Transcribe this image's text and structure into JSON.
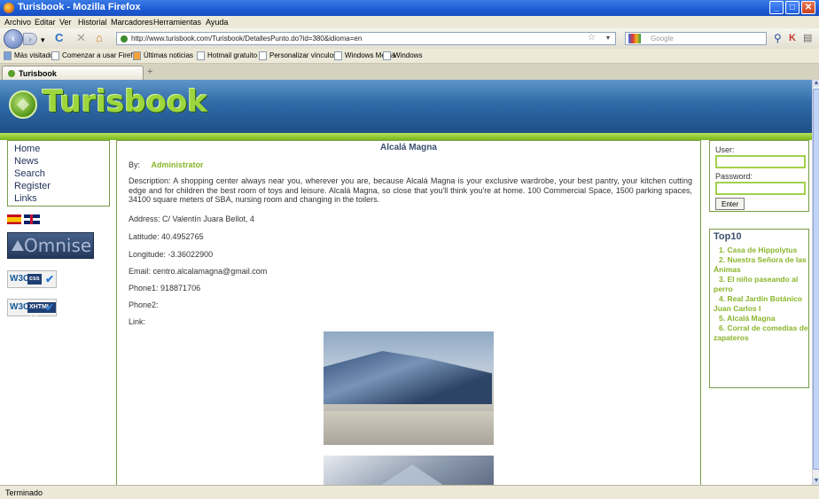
{
  "window": {
    "title": "Turisbook - Mozilla Firefox"
  },
  "menu": [
    "Archivo",
    "Editar",
    "Ver",
    "Historial",
    "Marcadores",
    "Herramientas",
    "Ayuda"
  ],
  "toolbar": {
    "url": "http://www.turisbook.com/Turisbook/DetallesPunto.do?id=380&idioma=en",
    "search_placeholder": "Google"
  },
  "bookmarks": [
    "Más visitados",
    "Comenzar a usar Firef...",
    "Últimas noticias",
    "Hotmail gratuito",
    "Personalizar vínculos",
    "Windows Media",
    "Windows"
  ],
  "tab": {
    "label": "Turisbook",
    "new_tab": "+"
  },
  "site": {
    "logo": "Turisbook"
  },
  "leftnav": [
    "Home",
    "News",
    "Search",
    "Register",
    "Links"
  ],
  "partner_logo": "Omnise",
  "badges": {
    "css": {
      "w3c": "W3C",
      "label": "css"
    },
    "xhtml": {
      "w3c": "W3C",
      "label": "XHTML 1.1"
    }
  },
  "place": {
    "title": "Alcalá Magna",
    "by_label": "By:",
    "author": "Administrator",
    "description": "Description: A shopping center always near you, wherever you are, because Alcalá Magna is your exclusive wardrobe, your best pantry, your kitchen cutting edge and for children the best room of toys and leisure. Alcalá Magna, so close that you'll think you're at home. 100 Commercial Space, 1500 parking spaces, 34100 square meters of SBA, nursing room and changing in the toilers.",
    "address": "Address: C/ Valentín Juara Bellot, 4",
    "latitude": "Latitude: 40.4952765",
    "longitude": "Longitude: -3.36022900",
    "email": "Email: centro.alcalamagna@gmail.com",
    "phone1": "Phone1: 918871706",
    "phone2": "Phone2:",
    "link": "Link:"
  },
  "login": {
    "user_label": "User:",
    "password_label": "Password:",
    "enter_label": "Enter"
  },
  "top10": {
    "heading": "Top10",
    "items": [
      "1. Casa de Hippolytus",
      "2. Nuestra Señora de las Ánimas",
      "3. El niño paseando al perro",
      "4. Real Jardín Botánico Juan Carlos I",
      "5. Alcalá Magna",
      "6. Corral de comedias de zapateros"
    ]
  },
  "status": "Terminado"
}
